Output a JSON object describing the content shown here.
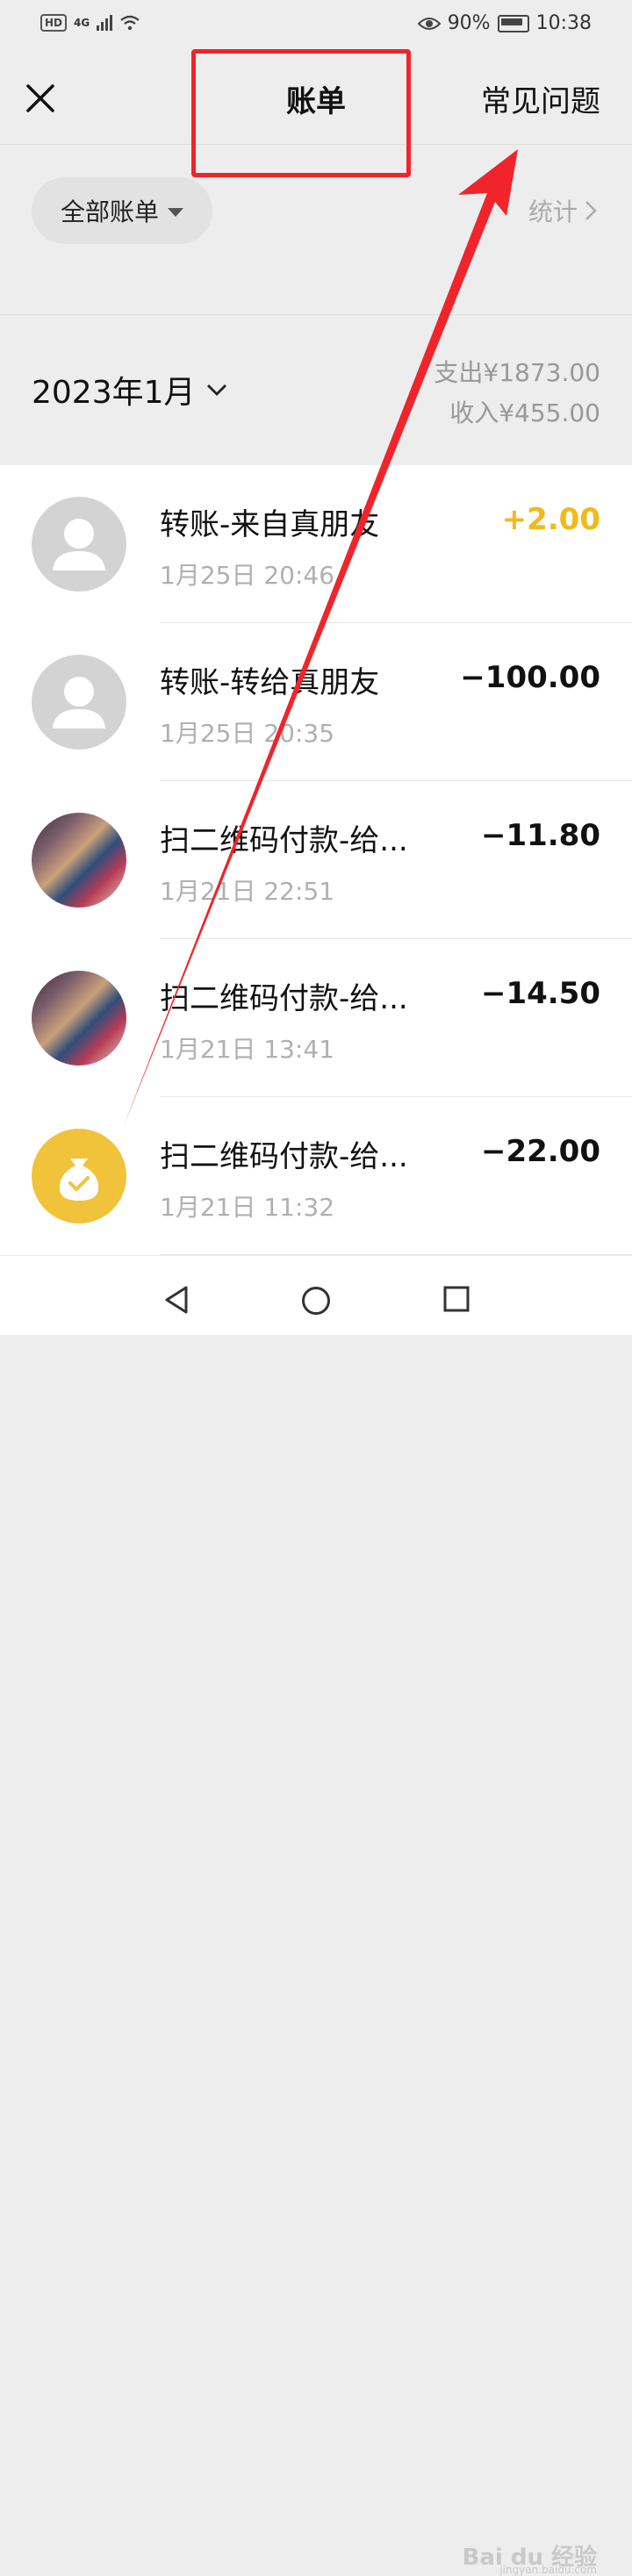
{
  "status": {
    "network": "4G",
    "battery": "90%",
    "time": "10:38"
  },
  "nav": {
    "title": "账单",
    "right": "常见问题"
  },
  "filter": {
    "label": "全部账单"
  },
  "stats": {
    "label": "统计"
  },
  "month": {
    "label": "2023年1月",
    "expense": "支出¥1873.00",
    "income": "收入¥455.00"
  },
  "transactions": [
    {
      "title": "转账-来自真朋友",
      "time": "1月25日 20:46",
      "amount": "+2.00"
    },
    {
      "title": "转账-转给真朋友",
      "time": "1月25日 20:35",
      "amount": "−100.00"
    },
    {
      "title": "扫二维码付款-给...",
      "time": "1月21日 22:51",
      "amount": "−11.80"
    },
    {
      "title": "扫二维码付款-给...",
      "time": "1月21日 13:41",
      "amount": "−14.50"
    },
    {
      "title": "扫二维码付款-给...",
      "time": "1月21日 11:32",
      "amount": "−22.00"
    }
  ],
  "colors": {
    "annotation": "#f0242a",
    "income_amount": "#f2b91a"
  }
}
